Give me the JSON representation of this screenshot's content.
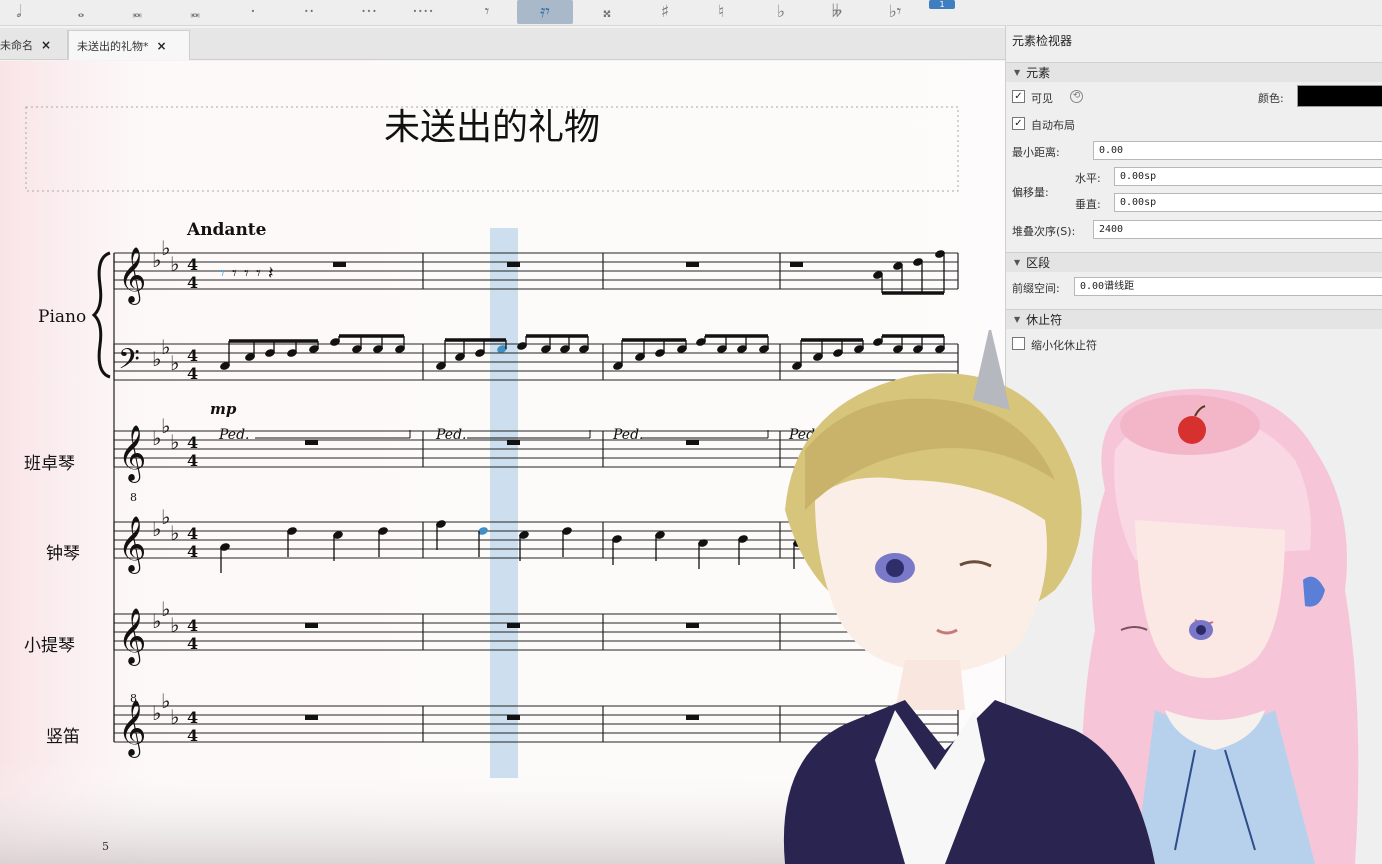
{
  "toolbar": {
    "buttons": [
      "𝅗𝅥",
      "𝅝",
      "𝅜",
      "𝅜",
      "·",
      "··",
      "···",
      "····",
      "𝄾",
      "𝄿𝄾",
      "𝄪",
      "♯",
      "♮",
      "♭",
      "𝄫",
      "♭𝄾"
    ],
    "mini_label": "1"
  },
  "tabs": [
    {
      "label": "未命名",
      "close": "×"
    },
    {
      "label": "未送出的礼物*",
      "close": "×"
    }
  ],
  "score": {
    "title": "未送出的礼物",
    "tempo": "Andante",
    "dynamic": "mp",
    "pedal": "Ped.",
    "instruments": [
      "Piano",
      "班卓琴",
      "钟琴",
      "小提琴",
      "竖笛"
    ],
    "next_measure_number": "5",
    "octave_mark": "8"
  },
  "inspector": {
    "title": "元素检视器",
    "element_section": "元素",
    "visible_label": "可见",
    "color_label": "颜色:",
    "auto_layout_label": "自动布局",
    "min_distance_label": "最小距离:",
    "min_distance_value": "0.00",
    "offset_label": "偏移量:",
    "horizontal_label": "水平:",
    "horizontal_value": "0.00sp",
    "vertical_label": "垂直:",
    "vertical_value": "0.00sp",
    "stacking_label": "堆叠次序(S):",
    "stacking_value": "2400",
    "segment_section": "区段",
    "leading_space_label": "前缀空间:",
    "leading_space_value": "0.00谱线距",
    "rest_section": "休止符",
    "small_rests_label": "缩小化休止符",
    "color_value": "#000000"
  }
}
